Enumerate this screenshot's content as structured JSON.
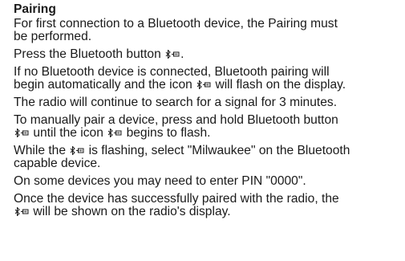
{
  "document": {
    "heading": "Pairing",
    "p1": {
      "line1": "For first connection to a Bluetooth device, the Pairing must",
      "line2": "be performed."
    },
    "p2": {
      "before_icon": "Press the Bluetooth button ",
      "after_icon": "."
    },
    "p3": {
      "line1": "If no Bluetooth device is connected, Bluetooth pairing will",
      "line2_before_icon": "begin automatically and the icon ",
      "line2_after_icon": " will flash on the display."
    },
    "p4": {
      "line1": "The radio will continue to search for a signal for 3 minutes."
    },
    "p5": {
      "line1": "To manually pair a device, press and hold Bluetooth button",
      "line2_after_icon1": " until the icon ",
      "line2_after_icon2": " begins to flash."
    },
    "p6": {
      "line1_before_icon": "While the ",
      "line1_after_icon": " is flashing, select \"Milwaukee\" on the Bluetooth",
      "line2": "capable device."
    },
    "p7": {
      "line1": "On some devices you may need to enter PIN \"0000\"."
    },
    "p8": {
      "line1": "Once the device has successfully paired with the radio, the",
      "line2_after_icon": " will be shown on the radio's display."
    },
    "icon": "bluetooth-icon"
  }
}
